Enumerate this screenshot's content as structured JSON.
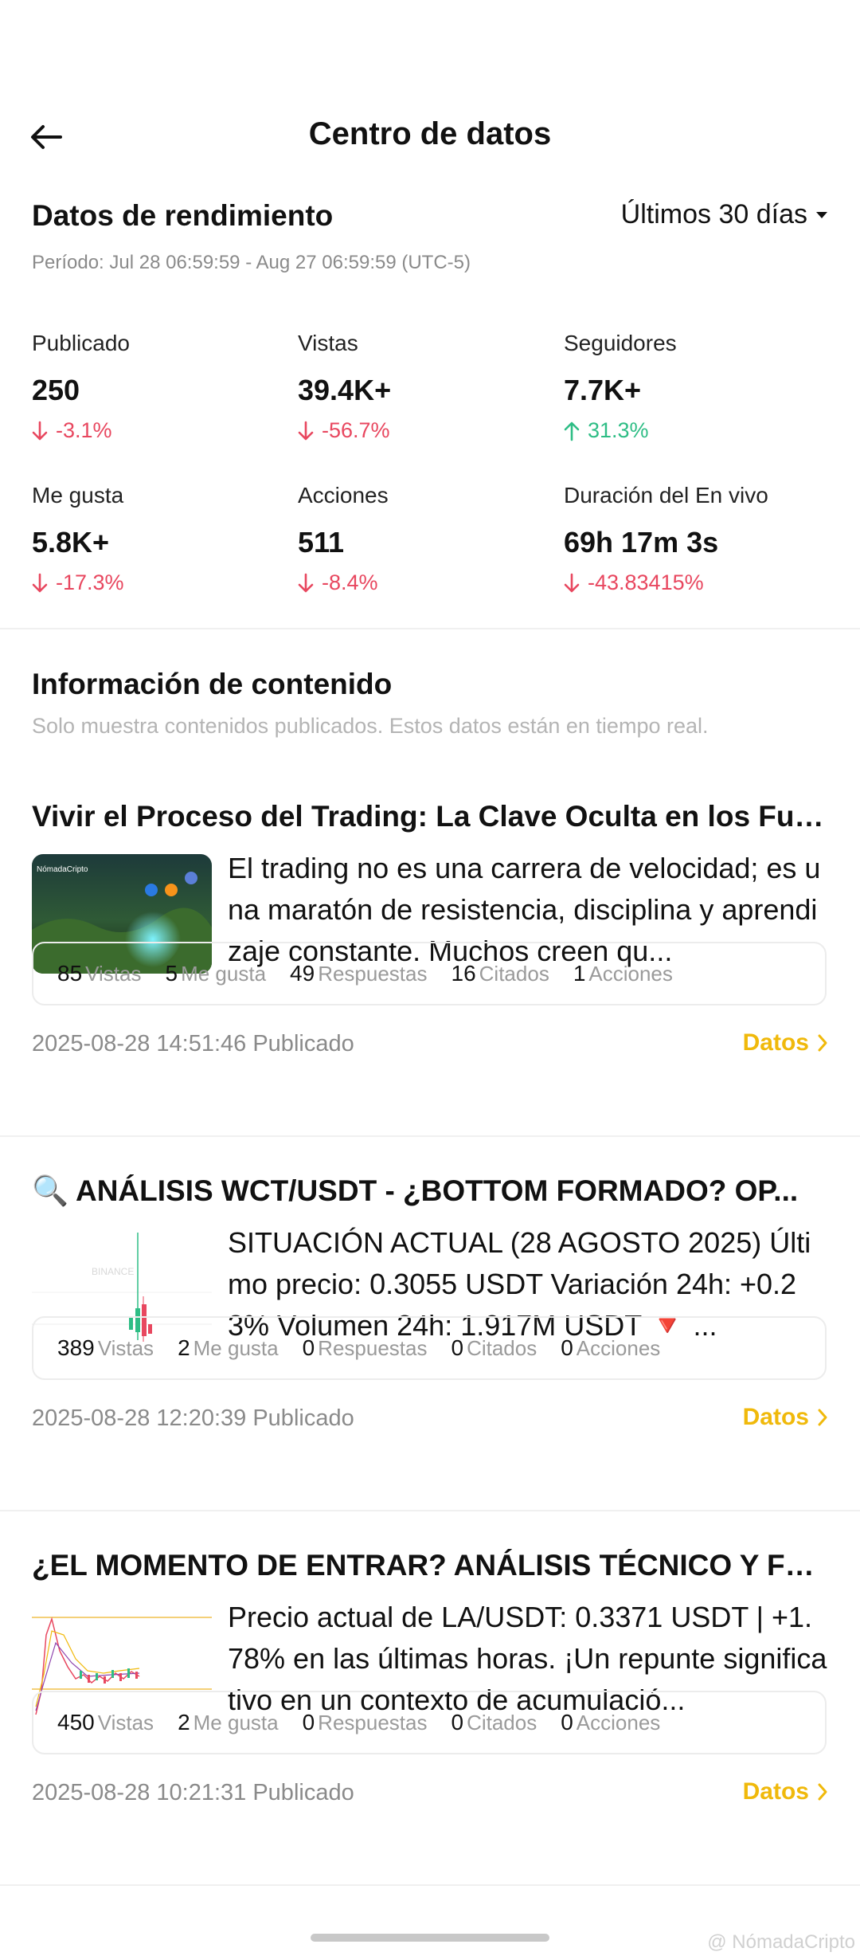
{
  "header": {
    "title": "Centro de datos"
  },
  "performance": {
    "title": "Datos de rendimiento",
    "range_selected": "Últimos 30 días",
    "period": "Período: Jul 28 06:59:59 - Aug 27 06:59:59 (UTC-5)",
    "metrics": [
      {
        "label": "Publicado",
        "value": "250",
        "change": "-3.1%",
        "direction": "down"
      },
      {
        "label": "Vistas",
        "value": "39.4K+",
        "change": "-56.7%",
        "direction": "down"
      },
      {
        "label": "Seguidores",
        "value": "7.7K+",
        "change": "31.3%",
        "direction": "up"
      },
      {
        "label": "Me gusta",
        "value": "5.8K+",
        "change": "-17.3%",
        "direction": "down"
      },
      {
        "label": "Acciones",
        "value": "511",
        "change": "-8.4%",
        "direction": "down"
      },
      {
        "label": "Duración del En vivo",
        "value": "69h 17m 3s",
        "change": "-43.83415%",
        "direction": "down"
      }
    ]
  },
  "content": {
    "title": "Información de contenido",
    "subtitle": "Solo muestra contenidos publicados. Estos datos están en tiempo real.",
    "stat_labels": {
      "views": "Vistas",
      "likes": "Me gusta",
      "replies": "Respuestas",
      "quotes": "Citados",
      "shares": "Acciones"
    },
    "datos_label": "Datos",
    "posts": [
      {
        "title": "Vivir el Proceso del Trading: La Clave Oculta en los Fut...",
        "excerpt": "El trading no es una carrera de velocidad; es una maratón de resistencia, disciplina y aprendizaje constante. Muchos creen qu...",
        "thumb_label": "NómadaCripto",
        "views": "85",
        "likes": "5",
        "replies": "49",
        "quotes": "16",
        "shares": "1",
        "published": "2025-08-28 14:51:46 Publicado"
      },
      {
        "title": "🔍 ANÁLISIS WCT/USDT - ¿BOTTOM FORMADO? OP...",
        "excerpt": "SITUACIÓN ACTUAL (28 AGOSTO 2025) Último precio: 0.3055 USDT Variación 24h: +0.23% Volumen 24h: 1.917M USDT 🔻 ...",
        "thumb_label": "BINANCE",
        "views": "389",
        "likes": "2",
        "replies": "0",
        "quotes": "0",
        "shares": "0",
        "published": "2025-08-28 12:20:39 Publicado"
      },
      {
        "title": "¿EL MOMENTO DE ENTRAR? ANÁLISIS TÉCNICO Y FU...",
        "excerpt": "Precio actual de LA/USDT: 0.3371 USDT | +1.78% en las últimas horas. ¡Un repunte significativo en un contexto de acumulació...",
        "thumb_label": "",
        "views": "450",
        "likes": "2",
        "replies": "0",
        "quotes": "0",
        "shares": "0",
        "published": "2025-08-28 10:21:31 Publicado"
      }
    ]
  },
  "watermark": "@ NómadaCripto",
  "colors": {
    "accent": "#f0b90b",
    "down": "#e8475f",
    "up": "#2ebd85"
  },
  "icons": {
    "back": "arrow-left-icon",
    "dropdown": "caret-down-icon",
    "chevron": "chevron-right-icon"
  }
}
